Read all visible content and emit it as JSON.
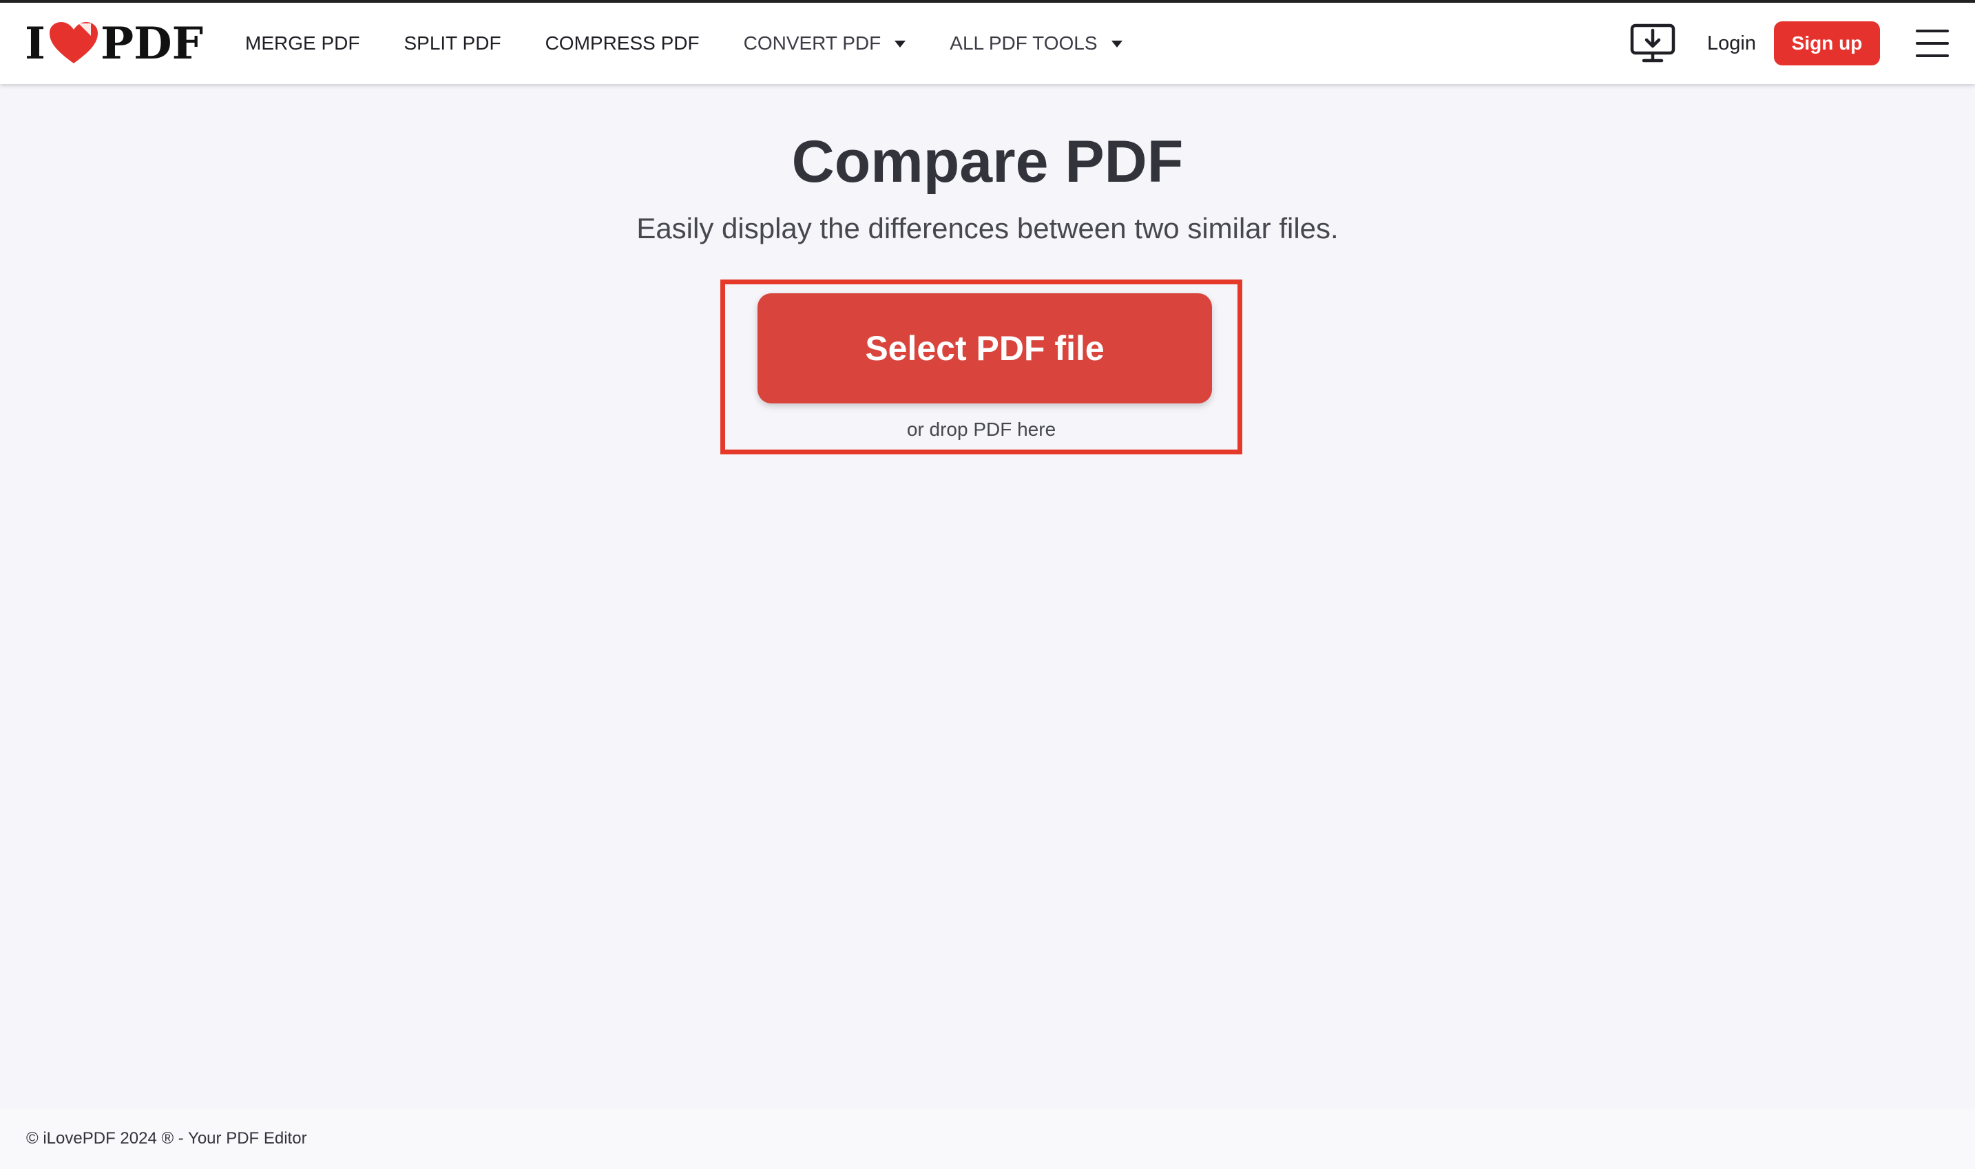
{
  "header": {
    "brand": {
      "prefix": "I",
      "suffix": "PDF"
    },
    "nav": [
      {
        "label": "MERGE PDF",
        "dropdown": false
      },
      {
        "label": "SPLIT PDF",
        "dropdown": false
      },
      {
        "label": "COMPRESS PDF",
        "dropdown": false
      },
      {
        "label": "CONVERT PDF",
        "dropdown": true
      },
      {
        "label": "ALL PDF TOOLS",
        "dropdown": true
      }
    ],
    "desktop_icon": "desktop-download-icon",
    "login_label": "Login",
    "signup_label": "Sign up",
    "menu_icon": "hamburger-menu-icon"
  },
  "main": {
    "title": "Compare PDF",
    "subtitle": "Easily display the differences between two similar files.",
    "select_button_label": "Select PDF file",
    "drop_hint": "or drop PDF here"
  },
  "footer": {
    "copyright": "© iLovePDF 2024 ® - Your PDF Editor"
  },
  "colors": {
    "brand_red": "#e5322d",
    "button_red": "#d9443c",
    "highlight_border": "#e53a2a",
    "page_bg": "#f5f5fa"
  }
}
